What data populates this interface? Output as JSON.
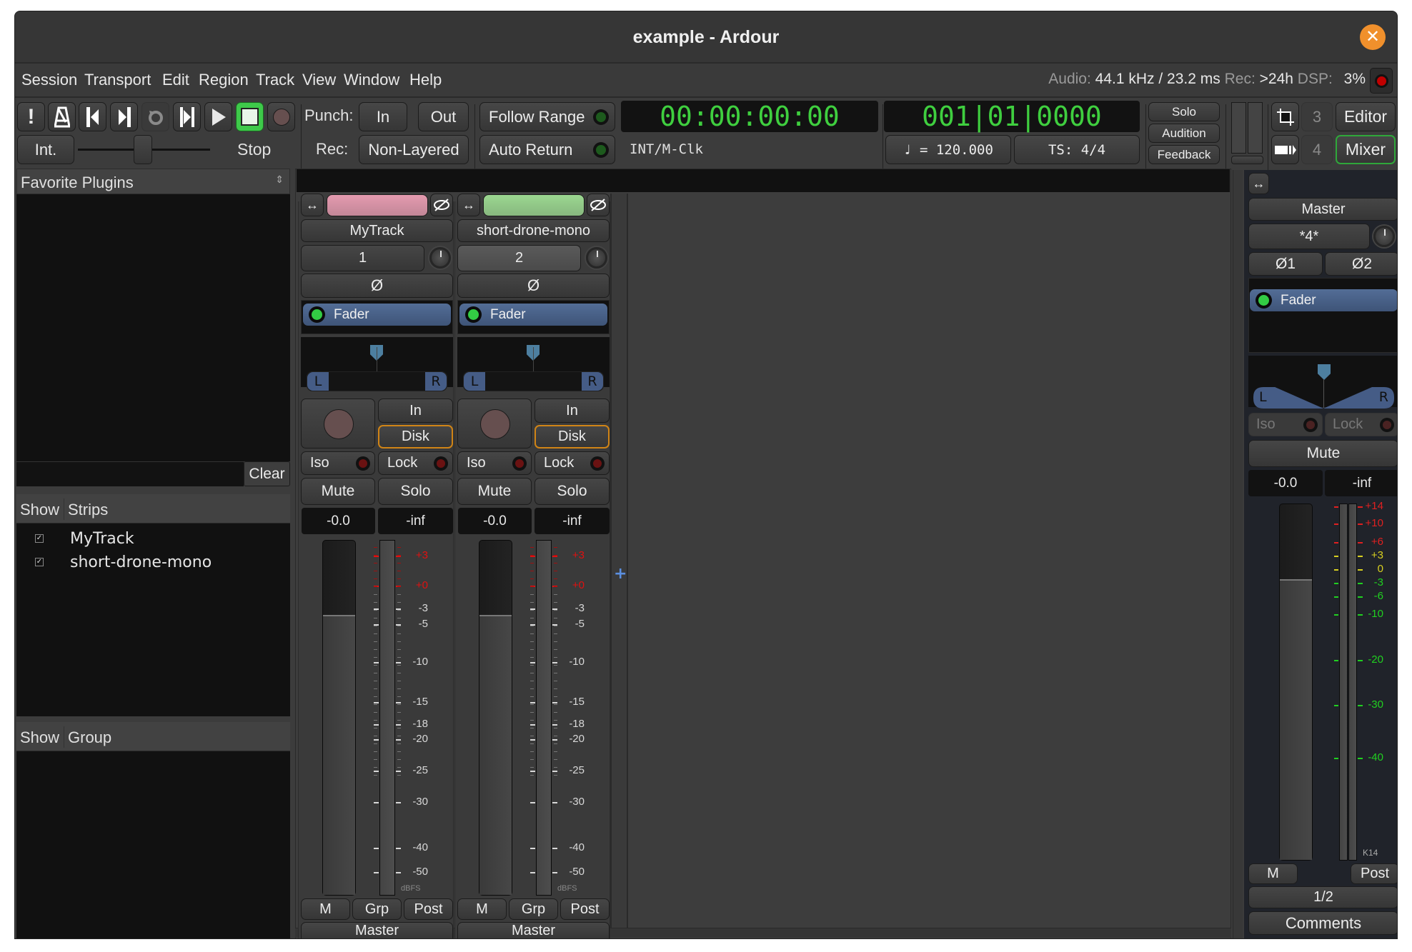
{
  "window": {
    "title": "example - Ardour",
    "close_icon": "close-icon"
  },
  "menu": [
    "Session",
    "Transport",
    "Edit",
    "Region",
    "Track",
    "View",
    "Window",
    "Help"
  ],
  "status": {
    "audio_label": "Audio:",
    "audio_value": "44.1 kHz / 23.2 ms",
    "rec_label": "Rec:",
    "rec_value": ">24h",
    "dsp_label": "DSP:",
    "dsp_value": "3%"
  },
  "transport": {
    "buttons": [
      "alert",
      "metronome",
      "goto-start",
      "goto-end",
      "loop",
      "play-range",
      "play",
      "stop",
      "record"
    ],
    "int_label": "Int.",
    "shuttle_state": "Stop",
    "punch_label": "Punch:",
    "punch_in": "In",
    "punch_out": "Out",
    "rec_label": "Rec:",
    "rec_mode": "Non-Layered",
    "follow_range": "Follow Range",
    "auto_return": "Auto Return",
    "primary_clock": "00:00:00:00",
    "sync_source": "INT/M-Clk",
    "secondary_clock": "001|01|0000",
    "tempo": "♩ = 120.000",
    "time_signature": "TS: 4/4",
    "solo": "Solo",
    "audition": "Audition",
    "feedback": "Feedback",
    "editor_num": "3",
    "mixer_num": "4",
    "editor": "Editor",
    "mixer": "Mixer",
    "accent_green": "#3fcf3f",
    "stop_active_color": "#3ec94a",
    "mixer_active_border": "#2fa83a"
  },
  "left_pane": {
    "favorites_title": "Favorite Plugins",
    "search_value": "",
    "clear": "Clear",
    "strips_header_show": "Show",
    "strips_header_name": "Strips",
    "strips": [
      {
        "name": "MyTrack",
        "shown": true
      },
      {
        "name": "short-drone-mono",
        "shown": true
      }
    ],
    "groups_header_show": "Show",
    "groups_header_name": "Group"
  },
  "strips": [
    {
      "name": "MyTrack",
      "color": "#e49aaf",
      "input": "1",
      "phase": "Ø",
      "plugin": "Fader",
      "pan_left": "L",
      "pan_right": "R",
      "in": "In",
      "disk": "Disk",
      "iso": "Iso",
      "lock": "Lock",
      "mute": "Mute",
      "solo": "Solo",
      "gain": "-0.0",
      "peak": "-inf",
      "gain_fader_fraction": 0.79,
      "meter_scale": [
        "+3",
        "+0",
        "-3",
        "-5",
        "-10",
        "-15",
        "-18",
        "-20",
        "-25",
        "-30",
        "-40",
        "-50"
      ],
      "meter_unit": "dBFS",
      "bottom": {
        "m": "M",
        "grp": "Grp",
        "post": "Post"
      },
      "output": "Master"
    },
    {
      "name": "short-drone-mono",
      "color": "#9bd790",
      "input": "2",
      "phase": "Ø",
      "plugin": "Fader",
      "pan_left": "L",
      "pan_right": "R",
      "in": "In",
      "disk": "Disk",
      "iso": "Iso",
      "lock": "Lock",
      "mute": "Mute",
      "solo": "Solo",
      "gain": "-0.0",
      "peak": "-inf",
      "gain_fader_fraction": 0.79,
      "meter_scale": [
        "+3",
        "+0",
        "-3",
        "-5",
        "-10",
        "-15",
        "-18",
        "-20",
        "-25",
        "-30",
        "-40",
        "-50"
      ],
      "meter_unit": "dBFS",
      "bottom": {
        "m": "M",
        "grp": "Grp",
        "post": "Post"
      },
      "output": "Master"
    }
  ],
  "add_strip_icon": "plus-icon",
  "master": {
    "name": "Master",
    "input": "*4*",
    "phase1": "Ø1",
    "phase2": "Ø2",
    "plugin": "Fader",
    "pan_left": "L",
    "pan_right": "R",
    "iso": "Iso",
    "lock": "Lock",
    "mute": "Mute",
    "gain": "-0.0",
    "peak": "-inf",
    "gain_fader_fraction": 0.79,
    "meter_scale": [
      {
        "label": "+14",
        "color": "#e02020"
      },
      {
        "label": "+10",
        "color": "#e02020"
      },
      {
        "label": "+6",
        "color": "#e02020"
      },
      {
        "label": "+3",
        "color": "#d8d020"
      },
      {
        "label": "0",
        "color": "#d8d020"
      },
      {
        "label": "-3",
        "color": "#20d020"
      },
      {
        "label": "-6",
        "color": "#20d020"
      },
      {
        "label": "-10",
        "color": "#20d020"
      },
      {
        "label": "-20",
        "color": "#20d020"
      },
      {
        "label": "-30",
        "color": "#20d020"
      },
      {
        "label": "-40",
        "color": "#20d020"
      }
    ],
    "meter_type": "K14",
    "m": "M",
    "post": "Post",
    "output": "1/2",
    "comments": "Comments"
  }
}
